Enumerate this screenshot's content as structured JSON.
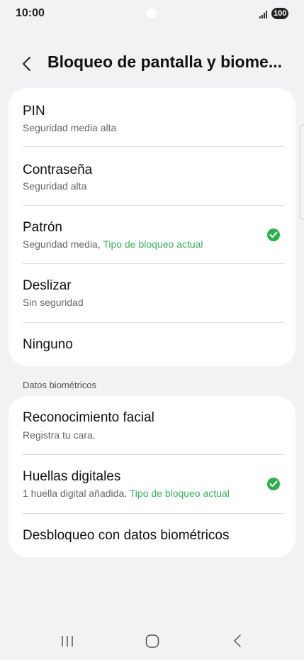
{
  "status_bar": {
    "time": "10:00",
    "battery": "100",
    "signal_icon": "signal-bars-icon"
  },
  "header": {
    "title": "Bloqueo de pantalla y biome...",
    "back_icon": "chevron-left-icon"
  },
  "lock_types": [
    {
      "title": "PIN",
      "subtitle": "Seguridad media alta"
    },
    {
      "title": "Contraseña",
      "subtitle": "Seguridad alta"
    },
    {
      "title": "Patrón",
      "subtitle": "Seguridad media, ",
      "subtitle_accent": "Tipo de bloqueo actual",
      "checked": true
    },
    {
      "title": "Deslizar",
      "subtitle": "Sin seguridad"
    },
    {
      "title": "Ninguno"
    }
  ],
  "biometrics_section": {
    "label": "Datos biométricos",
    "items": [
      {
        "title": "Reconocimiento facial",
        "subtitle": "Registra tu cara."
      },
      {
        "title": "Huellas digitales",
        "subtitle": "1 huella digital añadida, ",
        "subtitle_accent": "Tipo de bloqueo actual",
        "checked": true
      },
      {
        "title": "Desbloqueo con datos biométricos"
      }
    ]
  },
  "nav_bar": {
    "recents_icon": "recents-icon",
    "home_icon": "home-icon",
    "back_icon": "back-icon"
  },
  "colors": {
    "background": "#f2f2f4",
    "card": "#ffffff",
    "accent_green": "#3cae5c",
    "check_green": "#2fae4e"
  }
}
